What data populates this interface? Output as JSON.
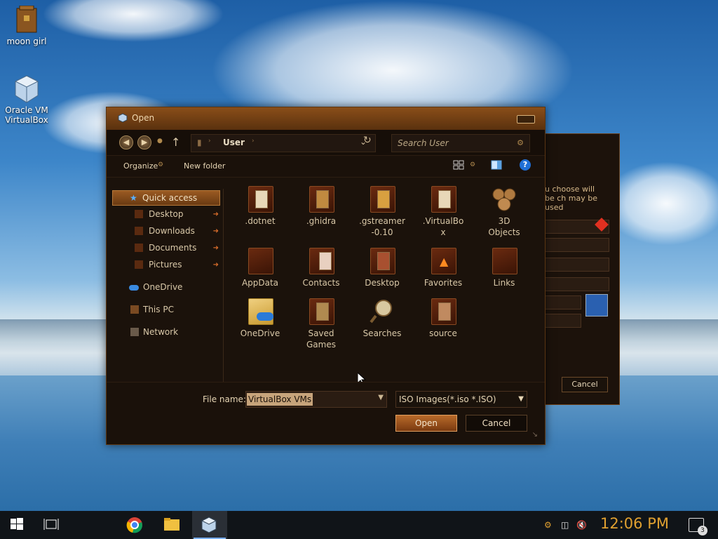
{
  "desktop": {
    "icons": [
      {
        "label": "moon girl",
        "icon": "package-box-icon"
      },
      {
        "label": "Oracle VM VirtualBox",
        "icon": "virtualbox-cube-icon"
      }
    ]
  },
  "back_dialog": {
    "text": "u choose will be ch may be used",
    "cancel_label": "Cancel"
  },
  "dialog": {
    "title": "Open",
    "address": {
      "location": "User"
    },
    "search": {
      "placeholder": "Search User"
    },
    "toolbar": {
      "organize": "Organize",
      "new_folder": "New folder"
    },
    "sidebar": {
      "items": [
        {
          "label": "Quick access",
          "icon": "star-icon"
        },
        {
          "label": "Desktop",
          "icon": "desktop-icon"
        },
        {
          "label": "Downloads",
          "icon": "downloads-icon"
        },
        {
          "label": "Documents",
          "icon": "documents-icon"
        },
        {
          "label": "Pictures",
          "icon": "pictures-icon"
        },
        {
          "label": "OneDrive",
          "icon": "cloud-icon"
        },
        {
          "label": "This PC",
          "icon": "computer-icon"
        },
        {
          "label": "Network",
          "icon": "network-icon"
        }
      ]
    },
    "files": [
      {
        "name": ".dotnet"
      },
      {
        "name": ".ghidra"
      },
      {
        "name": ".gstreamer -0.10"
      },
      {
        "name": ".VirtualBo x"
      },
      {
        "name": "3D Objects"
      },
      {
        "name": "AppData"
      },
      {
        "name": "Contacts"
      },
      {
        "name": "Desktop"
      },
      {
        "name": "Favorites"
      },
      {
        "name": "Links"
      },
      {
        "name": "OneDrive"
      },
      {
        "name": "Saved Games"
      },
      {
        "name": "Searches"
      },
      {
        "name": "source"
      }
    ],
    "file_name_label": "File name:",
    "file_name_value": "VirtualBox VMs",
    "file_type_value": "ISO Images(*.iso *.ISO)",
    "open_label": "Open",
    "cancel_label": "Cancel"
  },
  "taskbar": {
    "clock": "12:06 PM",
    "notification_count": "3"
  }
}
